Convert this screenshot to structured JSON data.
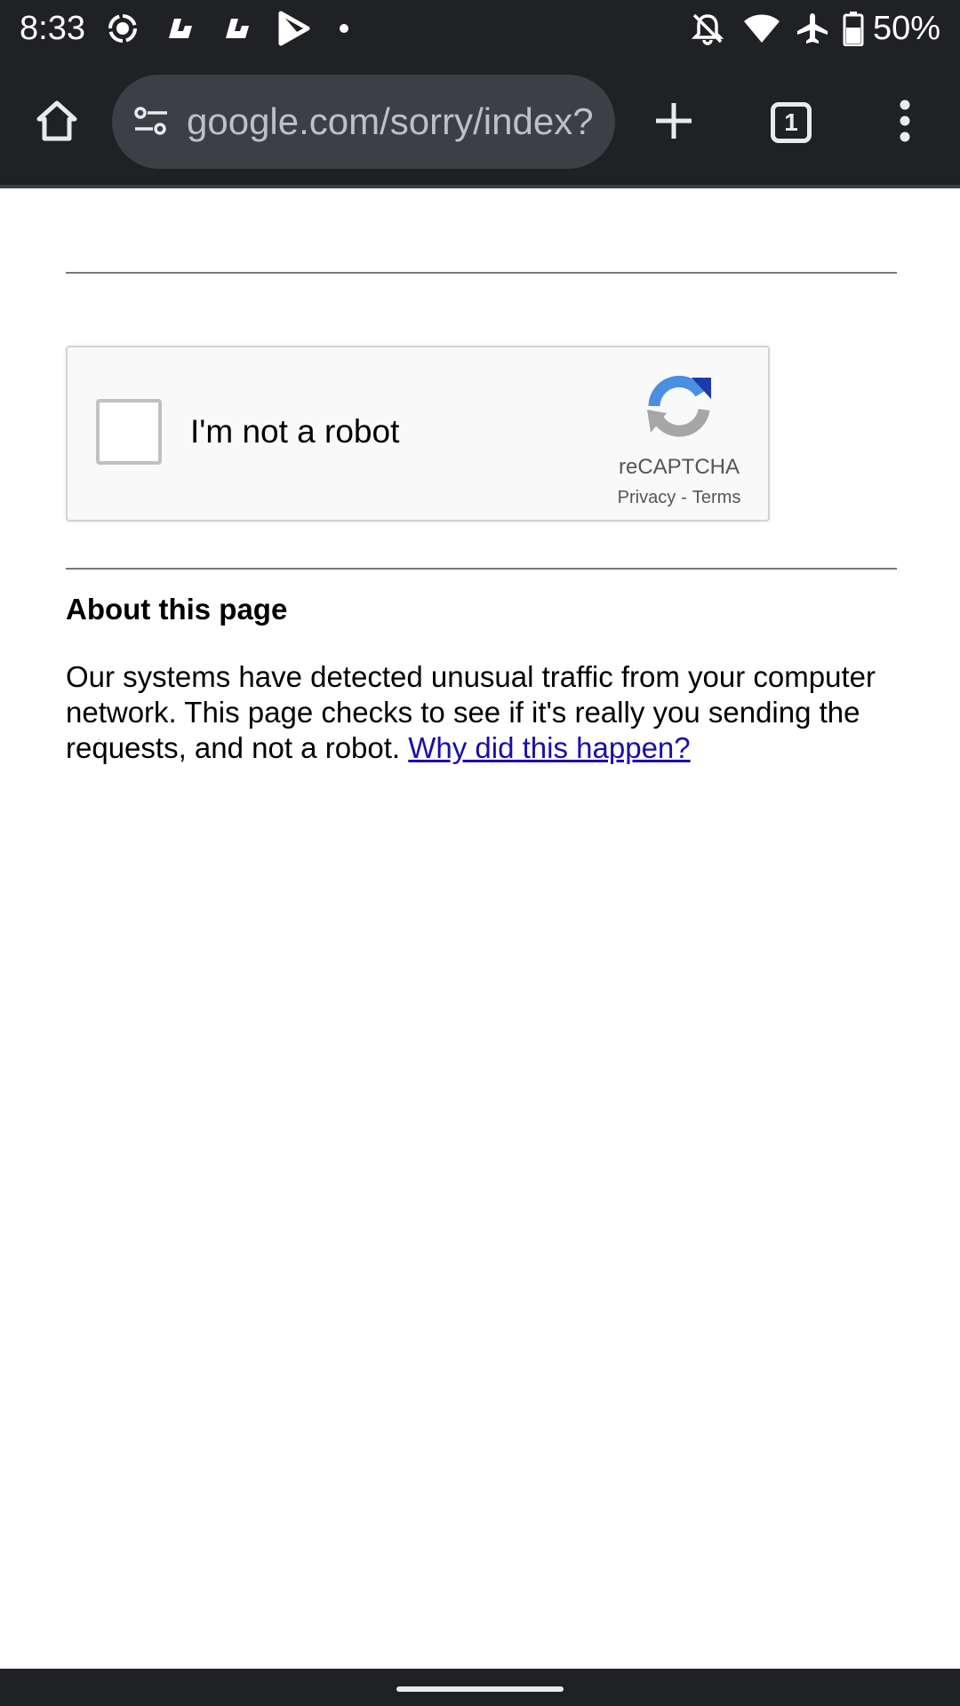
{
  "status_bar": {
    "time": "8:33",
    "left_icons": [
      "record-icon",
      "notification-app-icon",
      "notification-app-icon",
      "play-store-icon",
      "dot-icon"
    ],
    "right_icons": [
      "notifications-off-icon",
      "wifi-icon",
      "airplane-mode-icon",
      "battery-icon"
    ],
    "battery_percent": "50%"
  },
  "toolbar": {
    "url": "google.com/sorry/index?",
    "tab_count": "1",
    "icons": {
      "home": "home-icon",
      "site_settings": "tune-icon",
      "new_tab": "plus-icon",
      "menu": "more-vertical-icon"
    }
  },
  "captcha": {
    "label": "I'm not a robot",
    "brand": "reCAPTCHA",
    "privacy": "Privacy",
    "separator": "-",
    "terms": "Terms"
  },
  "about": {
    "heading": "About this page",
    "body": "Our systems have detected unusual traffic from your computer network. This page checks to see if it's really you sending the requests, and not a robot. ",
    "link": "Why did this happen?"
  },
  "colors": {
    "chrome_dark": "#202124",
    "omnibox": "#3c3f43",
    "link": "#1a0dab",
    "recaptcha_blue": "#1c3aa9",
    "recaptcha_light_blue": "#4a90e2",
    "recaptcha_gray": "#a6a6a6"
  }
}
